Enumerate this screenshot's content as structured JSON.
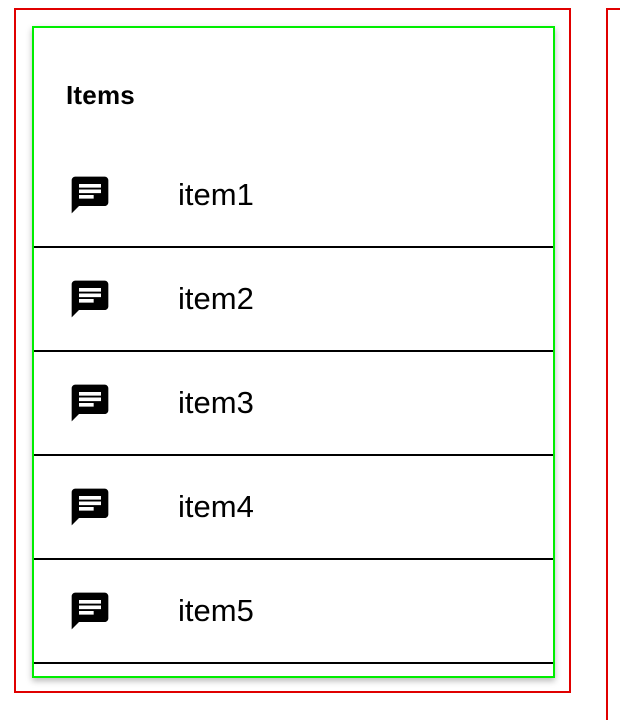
{
  "list": {
    "header": "Items",
    "items": [
      {
        "label": "item1",
        "icon": "message-icon"
      },
      {
        "label": "item2",
        "icon": "message-icon"
      },
      {
        "label": "item3",
        "icon": "message-icon"
      },
      {
        "label": "item4",
        "icon": "message-icon"
      },
      {
        "label": "item5",
        "icon": "message-icon"
      }
    ]
  },
  "colors": {
    "outer_frame": "#e00000",
    "card_border": "#00ee00",
    "divider": "#000000",
    "icon": "#000000"
  }
}
